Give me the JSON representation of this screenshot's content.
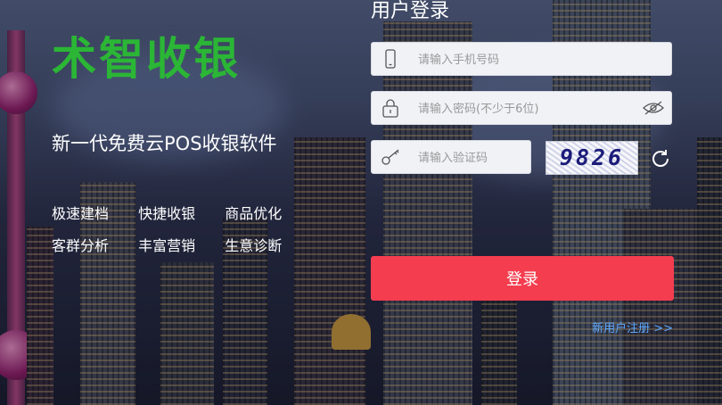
{
  "brand": {
    "name": "术智收银",
    "color": "#2bb636"
  },
  "promo": {
    "slogan": "新一代免费云POS收银软件",
    "features": [
      "极速建档",
      "快捷收银",
      "商品优化",
      "客群分析",
      "丰富营销",
      "生意诊断"
    ]
  },
  "login": {
    "title": "用户登录",
    "phone": {
      "placeholder": "请输入手机号码",
      "icon": "phone-icon"
    },
    "password": {
      "placeholder": "请输入密码(不少于6位)",
      "icon": "lock-icon",
      "toggle_icon": "eye-icon"
    },
    "captcha": {
      "placeholder": "请输入验证码",
      "icon": "key-icon",
      "code": "9826",
      "refresh_icon": "refresh-icon"
    },
    "submit_label": "登录",
    "submit_color": "#f43d4f",
    "register_link": "新用户注册 >>"
  }
}
